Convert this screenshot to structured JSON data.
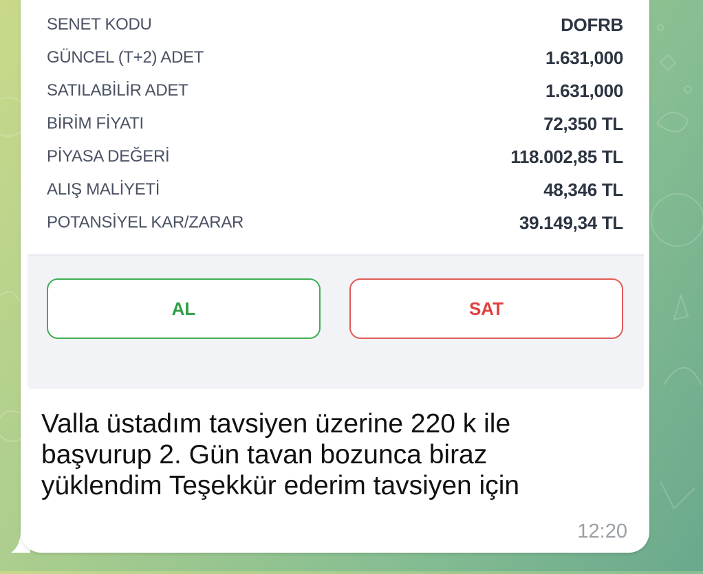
{
  "colors": {
    "buy_accent": "#3fae55",
    "sell_accent": "#e35a57",
    "bubble_bg": "#ffffff",
    "wallpaper": "#a9cd8e"
  },
  "card": {
    "rows": [
      {
        "label": "SENET KODU",
        "value": "DOFRB"
      },
      {
        "label": "GÜNCEL (T+2) ADET",
        "value": "1.631,000"
      },
      {
        "label": "SATILABİLİR ADET",
        "value": "1.631,000"
      },
      {
        "label": "BİRİM FİYATI",
        "value": "72,350 TL"
      },
      {
        "label": "PİYASA DEĞERİ",
        "value": "118.002,85 TL"
      },
      {
        "label": "ALIŞ MALİYETİ",
        "value": "48,346 TL"
      },
      {
        "label": "POTANSİYEL KAR/ZARAR",
        "value": "39.149,34 TL"
      }
    ],
    "buy_label": "AL",
    "sell_label": "SAT"
  },
  "message": {
    "text": "Valla üstadım tavsiyen üzerine 220 k ile\nbaşvurup 2. Gün tavan bozunca biraz\nyüklendim Teşekkür ederim tavsiyen için",
    "time": "12:20"
  }
}
